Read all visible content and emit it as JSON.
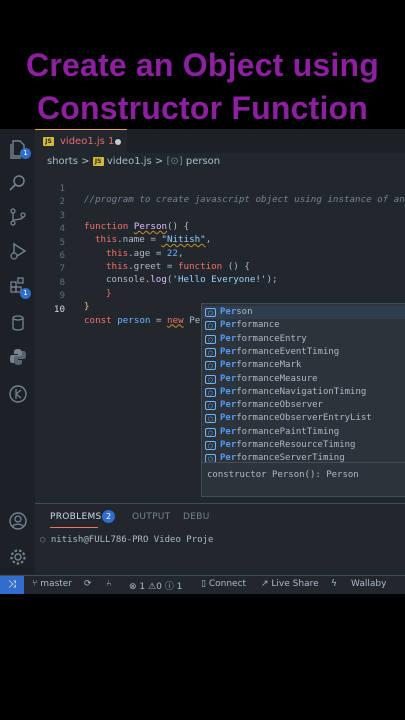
{
  "banner": {
    "line1": "Create an Object using",
    "line2": "Constructor Function"
  },
  "tab": {
    "filename": "video1.js",
    "problems": "1"
  },
  "breadcrumb": {
    "folder": "shorts",
    "sep": ">",
    "file": "video1.js",
    "symbol": "person"
  },
  "code": {
    "lines": [
      {
        "num": "1",
        "comment": "//program to create javascript object using instance of an o"
      },
      {
        "num": "2"
      },
      {
        "num": "3",
        "kw": "function",
        "name": "Person",
        "rest": "() {"
      },
      {
        "num": "4",
        "this": "this",
        "prop": ".name",
        "eq": " = ",
        "val": "\"Nitish\"",
        "end": ","
      },
      {
        "num": "5",
        "this": "this",
        "prop": ".age",
        "eq": " = ",
        "val": "22",
        "end": ","
      },
      {
        "num": "6",
        "this": "this",
        "prop": ".greet",
        "eq": " = ",
        "kw": "function",
        "rest": " () {"
      },
      {
        "num": "7",
        "obj": "console",
        "method": ".log",
        "open": "(",
        "str": "'Hello Everyone!'",
        "close": ");"
      },
      {
        "num": "8",
        "rest": "}"
      },
      {
        "num": "9",
        "rest": "}"
      },
      {
        "num": "10",
        "kw": "const",
        "name": "person",
        "eq": " = ",
        "kw2": "new",
        "typed": "Per"
      }
    ]
  },
  "suggestions": {
    "match": "Per",
    "items": [
      {
        "rest": "son",
        "selected": true
      },
      {
        "rest": "formance"
      },
      {
        "rest": "formanceEntry"
      },
      {
        "rest": "formanceEventTiming"
      },
      {
        "rest": "formanceMark"
      },
      {
        "rest": "formanceMeasure"
      },
      {
        "rest": "formanceNavigationTiming"
      },
      {
        "rest": "formanceObserver"
      },
      {
        "rest": "formanceObserverEntryList"
      },
      {
        "rest": "formancePaintTiming"
      },
      {
        "rest": "formanceResourceTiming"
      },
      {
        "rest": "formanceServerTiming"
      }
    ],
    "detail": "constructor Person(): Person"
  },
  "panel": {
    "tabs": {
      "problems": "PROBLEMS",
      "problems_count": "2",
      "output": "OUTPUT",
      "debug": "DEBU"
    },
    "terminal": "nitish@FULL786-PRO Video Proje"
  },
  "activity_badges": {
    "explorer": "1",
    "extensions": "1"
  },
  "status": {
    "branch": "master",
    "errors": "1",
    "warnings": "0",
    "info": "1",
    "connect": "Connect",
    "liveshare": "Live Share",
    "wallaby": "Wallaby"
  },
  "colors": {
    "banner": "#8e1fa0",
    "accent": "#316dca",
    "editor_bg": "#22272e"
  }
}
